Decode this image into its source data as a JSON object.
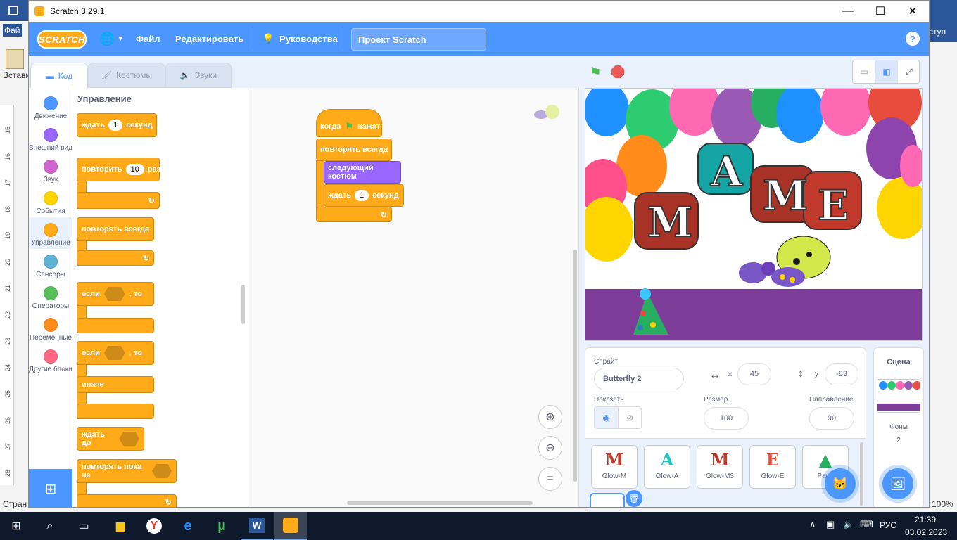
{
  "window": {
    "title": "Scratch 3.29.1"
  },
  "bg_app": {
    "menu_left": "Фай",
    "menu_right": "ступ",
    "paste_label": "Встави",
    "status_left": "Стран",
    "zoom_pct": "100%",
    "ruler_ticks": [
      "15",
      "16",
      "17",
      "18",
      "19",
      "20",
      "21",
      "22",
      "23",
      "24",
      "25",
      "26",
      "27",
      "28"
    ]
  },
  "menubar": {
    "logo": "SCRATCH",
    "file": "Файл",
    "edit": "Редактировать",
    "tutorials": "Руководства",
    "project_title": "Проект Scratch"
  },
  "tabs": {
    "code": "Код",
    "costumes": "Костюмы",
    "sounds": "Звуки"
  },
  "categories": [
    {
      "label": "Движение",
      "color": "#4c97ff"
    },
    {
      "label": "Внешний вид",
      "color": "#9966ff"
    },
    {
      "label": "Звук",
      "color": "#cf63cf"
    },
    {
      "label": "События",
      "color": "#ffd500"
    },
    {
      "label": "Управление",
      "color": "#ffab19"
    },
    {
      "label": "Сенсоры",
      "color": "#5cb1d6"
    },
    {
      "label": "Операторы",
      "color": "#59c059"
    },
    {
      "label": "Переменные",
      "color": "#ff8c1a"
    },
    {
      "label": "Другие блоки",
      "color": "#ff6680"
    }
  ],
  "palette": {
    "heading": "Управление",
    "wait": "ждать",
    "wait_val": "1",
    "seconds": "секунд",
    "repeat": "повторить",
    "repeat_val": "10",
    "times": "раз",
    "forever": "повторять всегда",
    "if": "если",
    "then": ", то",
    "if2": "если",
    "then2": ", то",
    "else": "иначе",
    "wait_until": "ждать до",
    "repeat_until": "повторять пока не"
  },
  "script": {
    "when_flag": "когда",
    "clicked": "нажат",
    "forever": "повторять всегда",
    "next_costume": "следующий костюм",
    "wait": "ждать",
    "wait_val": "1",
    "seconds": "секунд"
  },
  "sprite_info": {
    "sprite_label": "Спрайт",
    "sprite_name": "Butterfly 2",
    "x_label": "x",
    "x": "45",
    "y_label": "y",
    "y": "-83",
    "show_label": "Показать",
    "size_label": "Размер",
    "size": "100",
    "direction_label": "Направление",
    "direction": "90"
  },
  "sprites": [
    {
      "name": "Glow-M",
      "glyph": "M",
      "color": "#c0392b"
    },
    {
      "name": "Glow-A",
      "glyph": "A",
      "color": "#1fc7c7"
    },
    {
      "name": "Glow-M3",
      "glyph": "M",
      "color": "#c0392b"
    },
    {
      "name": "Glow-E",
      "glyph": "E",
      "color": "#e74c3c"
    },
    {
      "name": "Party",
      "glyph": "▲",
      "color": "#27ae60"
    }
  ],
  "stage_pane": {
    "label": "Сцена",
    "backdrops_label": "Фоны",
    "backdrops_count": "2"
  },
  "stage_letters": [
    "M",
    "A",
    "M",
    "E"
  ],
  "taskbar": {
    "time": "21:39",
    "date": "03.02.2023",
    "lang": "РУС"
  }
}
